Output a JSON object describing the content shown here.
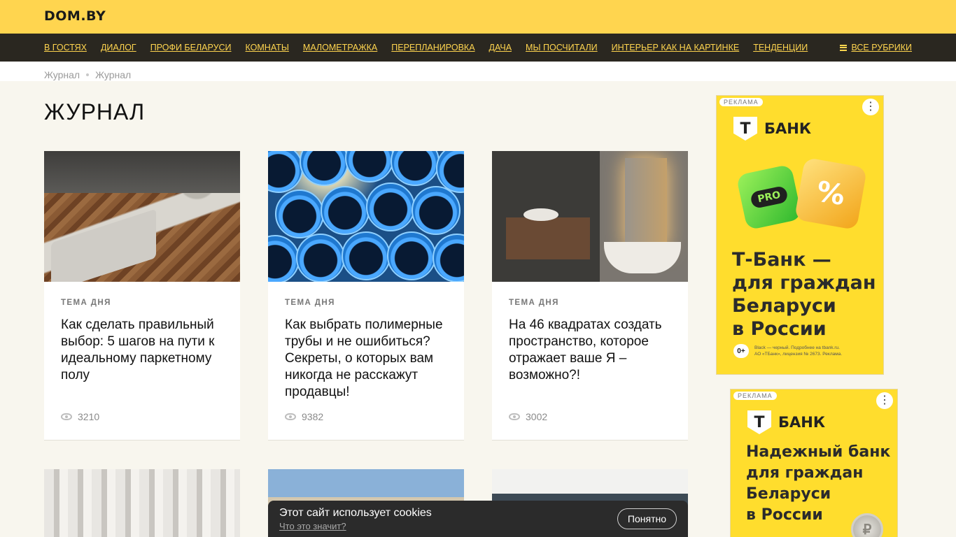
{
  "header": {
    "logo": "DOM.BY"
  },
  "nav": {
    "items": [
      {
        "label": "В ГОСТЯХ"
      },
      {
        "label": "ДИАЛОГ"
      },
      {
        "label": "ПРОФИ БЕЛАРУСИ"
      },
      {
        "label": "КОМНАТЫ"
      },
      {
        "label": "МАЛОМЕТРАЖКА"
      },
      {
        "label": "ПЕРЕПЛАНИРОВКА"
      },
      {
        "label": "ДАЧА"
      },
      {
        "label": "МЫ ПОСЧИТАЛИ"
      },
      {
        "label": "ИНТЕРЬЕР КАК НА КАРТИНКЕ"
      },
      {
        "label": "ТЕНДЕНЦИИ"
      }
    ],
    "all_rubrics": "ВСЕ РУБРИКИ"
  },
  "breadcrumb": [
    "Журнал",
    "Журнал"
  ],
  "page": {
    "title": "ЖУРНАЛ"
  },
  "articles": [
    {
      "tag": "ТЕМА ДНЯ",
      "title": "Как сделать правильный выбор: 5 шагов на пути к идеальному паркетному полу",
      "views": "3210"
    },
    {
      "tag": "ТЕМА ДНЯ",
      "title": "Как выбрать полимерные трубы и не ошибиться? Секреты, о которых вам никогда не расскажут продавцы!",
      "views": "9382"
    },
    {
      "tag": "ТЕМА ДНЯ",
      "title": "На 46 квадратах создать пространство, которое отражает ваше Я – возможно?!",
      "views": "3002"
    }
  ],
  "ads": [
    {
      "badge": "РЕКЛАМА",
      "brand_letter": "Т",
      "brand": "БАНК",
      "pro_label": "PRO",
      "headline_lines": [
        "Т-Банк —",
        "для граждан",
        "Беларуси",
        "в России"
      ],
      "age": "0+",
      "fine_print_1": "Black — черный. Подробнее на tbank.ru.",
      "fine_print_2": "АО «ТБанк», лицензия № 2673. Реклама.",
      "accent_color": "#ffdd2d"
    },
    {
      "badge": "РЕКЛАМА",
      "brand_letter": "Т",
      "brand": "БАНК",
      "headline_lines": [
        "Надежный банк",
        "для граждан",
        "Беларуси",
        "в России"
      ],
      "accent_color": "#ffdd2d"
    }
  ],
  "cookie": {
    "text": "Этот сайт использует cookies",
    "link": "Что это значит?",
    "button": "Понятно"
  },
  "colors": {
    "topbar": "#ffd54f",
    "navbar": "#2a2720",
    "background": "#f8f6ee"
  }
}
